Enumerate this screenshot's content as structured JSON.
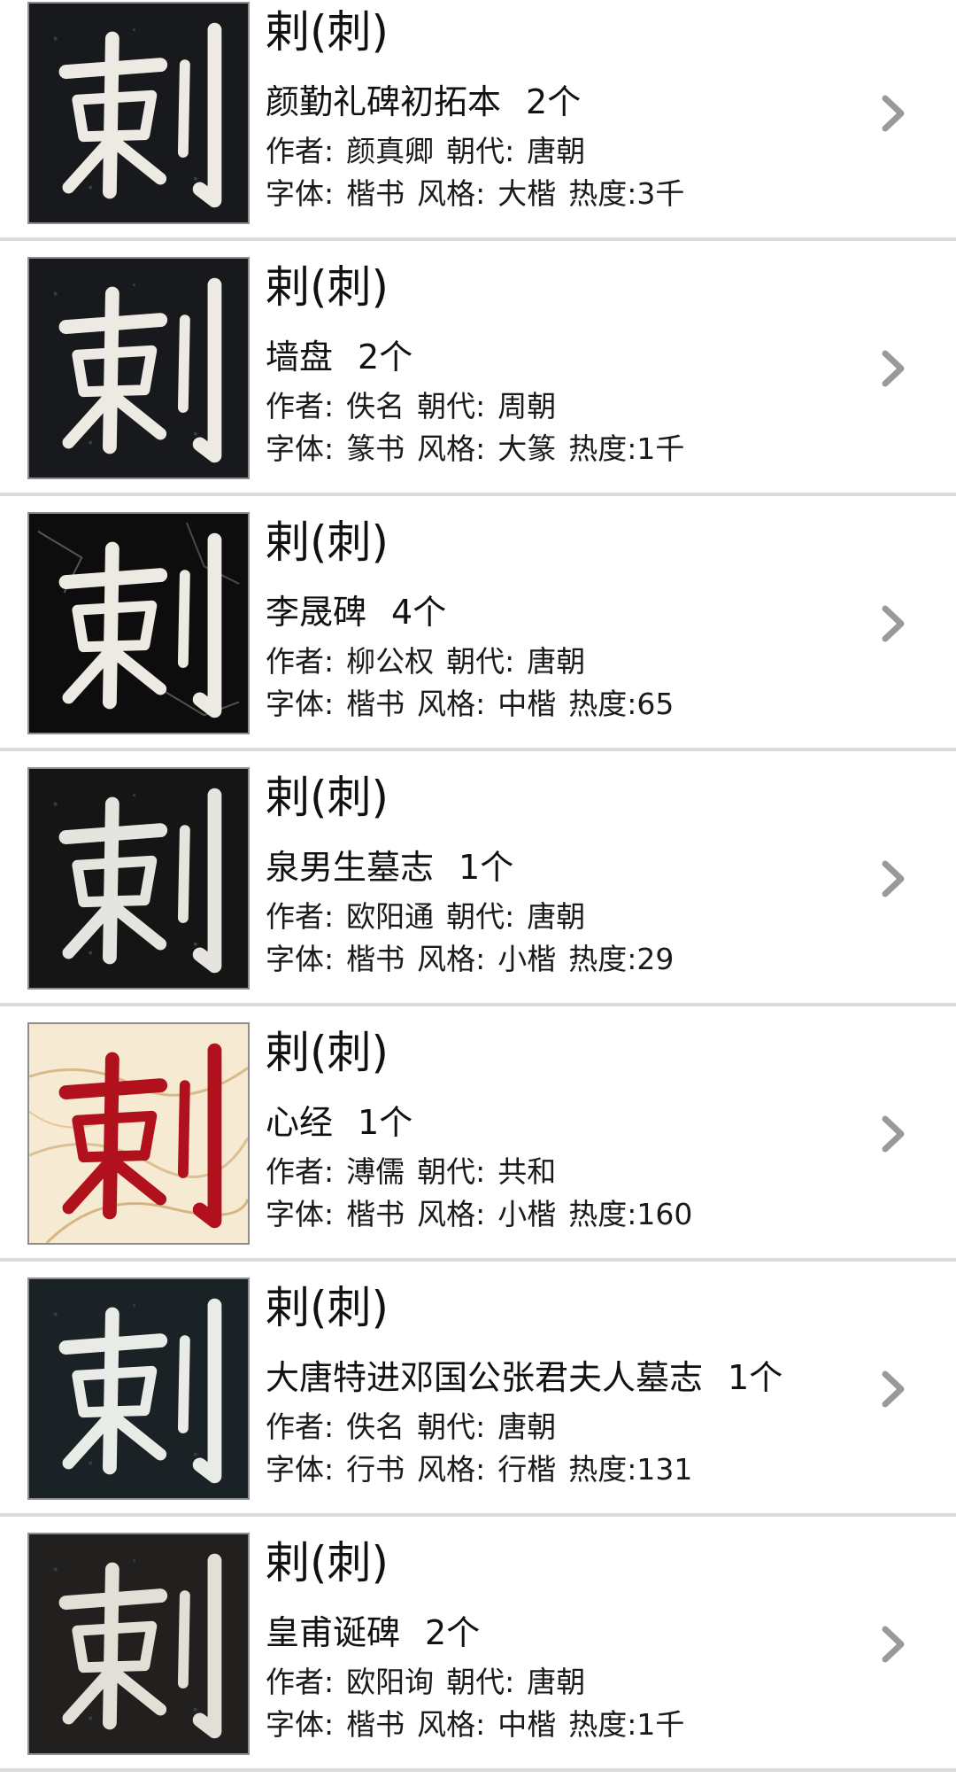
{
  "list": {
    "items": [
      {
        "character": "剌(刺)",
        "work": "颜勤礼碑初拓本",
        "count": "2个",
        "author_label": "作者:",
        "author": "颜真卿",
        "dynasty_label": "朝代:",
        "dynasty": "唐朝",
        "script_label": "字体:",
        "script": "楷书",
        "style_label": "风格:",
        "style": "大楷",
        "heat_label": "热度:",
        "heat": "3千",
        "thumb_theme": "dark-stone"
      },
      {
        "character": "剌(刺)",
        "work": "墙盘",
        "count": "2个",
        "author_label": "作者:",
        "author": "佚名",
        "dynasty_label": "朝代:",
        "dynasty": "周朝",
        "script_label": "字体:",
        "script": "篆书",
        "style_label": "风格:",
        "style": "大篆",
        "heat_label": "热度:",
        "heat": "1千",
        "thumb_theme": "dark-stone"
      },
      {
        "character": "剌(刺)",
        "work": "李晟碑",
        "count": "4个",
        "author_label": "作者:",
        "author": "柳公权",
        "dynasty_label": "朝代:",
        "dynasty": "唐朝",
        "script_label": "字体:",
        "script": "楷书",
        "style_label": "风格:",
        "style": "中楷",
        "heat_label": "热度:",
        "heat": "65",
        "thumb_theme": "black-cracked"
      },
      {
        "character": "剌(刺)",
        "work": "泉男生墓志",
        "count": "1个",
        "author_label": "作者:",
        "author": "欧阳通",
        "dynasty_label": "朝代:",
        "dynasty": "唐朝",
        "script_label": "字体:",
        "script": "楷书",
        "style_label": "风格:",
        "style": "小楷",
        "heat_label": "热度:",
        "heat": "29",
        "thumb_theme": "black-plain"
      },
      {
        "character": "剌(刺)",
        "work": "心经",
        "count": "1个",
        "author_label": "作者:",
        "author": "溥儒",
        "dynasty_label": "朝代:",
        "dynasty": "共和",
        "script_label": "字体:",
        "script": "楷书",
        "style_label": "风格:",
        "style": "小楷",
        "heat_label": "热度:",
        "heat": "160",
        "thumb_theme": "red-ink-paper"
      },
      {
        "character": "剌(刺)",
        "work": "大唐特进邓国公张君夫人墓志",
        "count": "1个",
        "author_label": "作者:",
        "author": "佚名",
        "dynasty_label": "朝代:",
        "dynasty": "唐朝",
        "script_label": "字体:",
        "script": "行书",
        "style_label": "风格:",
        "style": "行楷",
        "heat_label": "热度:",
        "heat": "131",
        "thumb_theme": "dark-slate"
      },
      {
        "character": "剌(刺)",
        "work": "皇甫诞碑",
        "count": "2个",
        "author_label": "作者:",
        "author": "欧阳询",
        "dynasty_label": "朝代:",
        "dynasty": "唐朝",
        "script_label": "字体:",
        "script": "楷书",
        "style_label": "风格:",
        "style": "中楷",
        "heat_label": "热度:",
        "heat": "1千",
        "thumb_theme": "charcoal"
      }
    ],
    "chevron_icon": "chevron-right-icon"
  },
  "colors": {
    "divider": "#dcdcdc",
    "chevron": "#9a9a9a",
    "text": "#111111",
    "stone_dark": "#17191d",
    "stone_ink": "#eceae2",
    "paper": "#f6ead3",
    "red_ink": "#b0111d"
  }
}
